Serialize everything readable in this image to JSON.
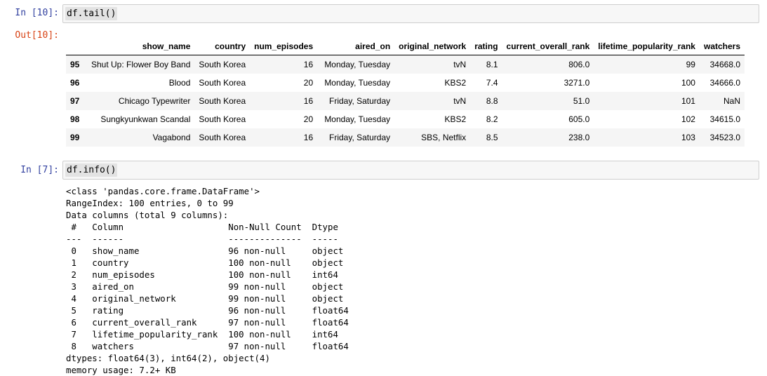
{
  "cells": {
    "tail": {
      "in_prompt": "In [10]:",
      "out_prompt": "Out[10]:",
      "code": "df.tail()"
    },
    "info": {
      "in_prompt": "In [7]:",
      "code": "df.info()"
    }
  },
  "dataframe": {
    "columns": [
      "",
      "show_name",
      "country",
      "num_episodes",
      "aired_on",
      "original_network",
      "rating",
      "current_overall_rank",
      "lifetime_popularity_rank",
      "watchers"
    ],
    "rows": [
      [
        "95",
        "Shut Up: Flower Boy Band",
        "South Korea",
        "16",
        "Monday, Tuesday",
        "tvN",
        "8.1",
        "806.0",
        "99",
        "34668.0"
      ],
      [
        "96",
        "Blood",
        "South Korea",
        "20",
        "Monday, Tuesday",
        "KBS2",
        "7.4",
        "3271.0",
        "100",
        "34666.0"
      ],
      [
        "97",
        "Chicago Typewriter",
        "South Korea",
        "16",
        "Friday, Saturday",
        "tvN",
        "8.8",
        "51.0",
        "101",
        "NaN"
      ],
      [
        "98",
        "Sungkyunkwan Scandal",
        "South Korea",
        "20",
        "Monday, Tuesday",
        "KBS2",
        "8.2",
        "605.0",
        "102",
        "34615.0"
      ],
      [
        "99",
        "Vagabond",
        "South Korea",
        "16",
        "Friday, Saturday",
        "SBS, Netflix",
        "8.5",
        "238.0",
        "103",
        "34523.0"
      ]
    ]
  },
  "info_output": {
    "lines": [
      "<class 'pandas.core.frame.DataFrame'>",
      "RangeIndex: 100 entries, 0 to 99",
      "Data columns (total 9 columns):",
      " #   Column                    Non-Null Count  Dtype  ",
      "---  ------                    --------------  -----  ",
      " 0   show_name                 96 non-null     object ",
      " 1   country                   100 non-null    object ",
      " 2   num_episodes              100 non-null    int64  ",
      " 3   aired_on                  99 non-null     object ",
      " 4   original_network          99 non-null     object ",
      " 5   rating                    96 non-null     float64",
      " 6   current_overall_rank      97 non-null     float64",
      " 7   lifetime_popularity_rank  100 non-null    int64  ",
      " 8   watchers                  97 non-null     float64",
      "dtypes: float64(3), int64(2), object(4)",
      "memory usage: 7.2+ KB"
    ]
  },
  "colors": {
    "in_prompt": "#303f9f",
    "out_prompt": "#d84315",
    "input_bg": "#f7f7f7",
    "input_border": "#cfcfcf",
    "row_stripe": "#f5f5f5"
  }
}
